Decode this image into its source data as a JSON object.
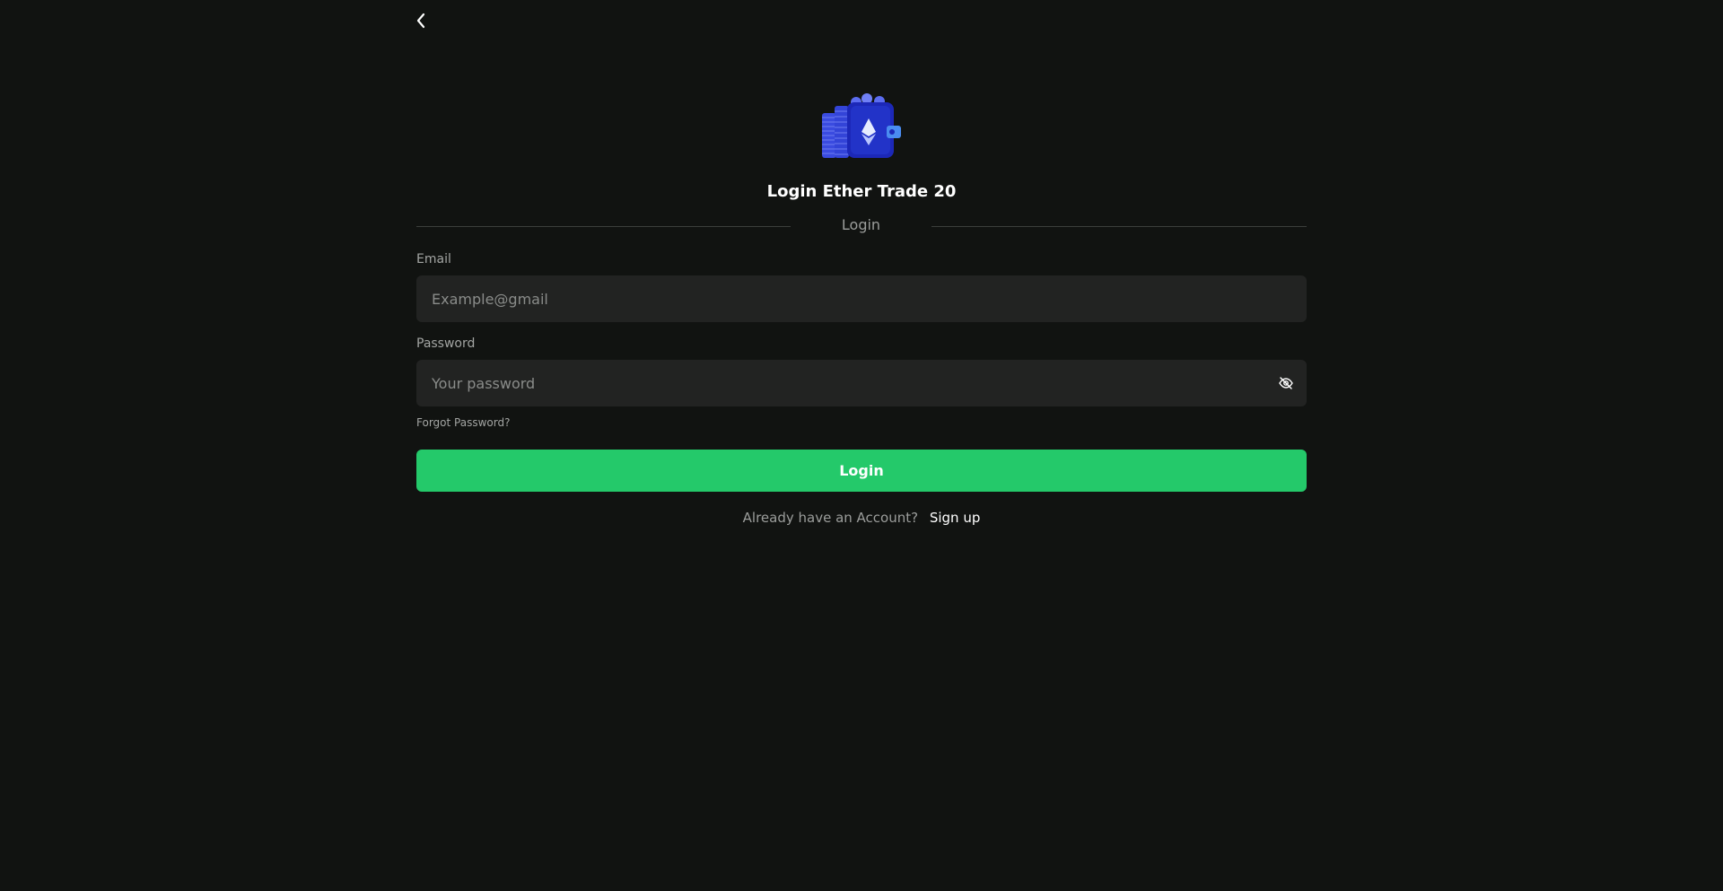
{
  "nav": {
    "back_icon": "chevron-left-icon"
  },
  "logo": {
    "icon": "ethereum-wallet-logo"
  },
  "header": {
    "title": "Login Ether Trade 20",
    "divider_label": "Login"
  },
  "form": {
    "email": {
      "label": "Email",
      "placeholder": "Example@gmail",
      "value": ""
    },
    "password": {
      "label": "Password",
      "placeholder": "Your password",
      "value": "",
      "toggle_icon": "eye-off-icon"
    },
    "forgot_label": "Forgot Password?",
    "submit_label": "Login"
  },
  "footer": {
    "prompt": "Already have an Account?",
    "link_label": "Sign up"
  },
  "colors": {
    "background": "#111311",
    "input_bg": "#222322",
    "accent": "#24c96a",
    "logo_blue": "#2f3fd6"
  }
}
